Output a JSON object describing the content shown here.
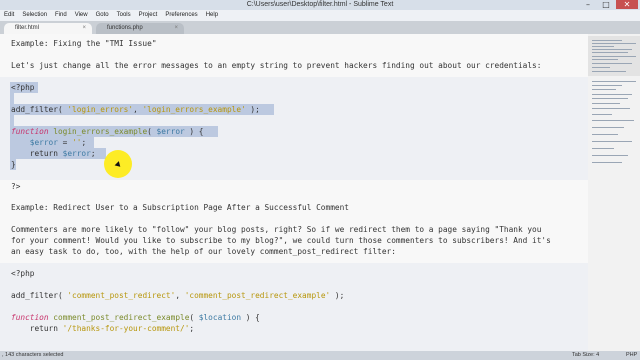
{
  "window": {
    "title": "C:\\Users\\user\\Desktop\\filter.html - Sublime Text"
  },
  "menu": [
    "Edit",
    "Selection",
    "Find",
    "View",
    "Goto",
    "Tools",
    "Project",
    "Preferences",
    "Help"
  ],
  "tabs": [
    {
      "label": "filter.html",
      "active": true
    },
    {
      "label": "functions.php",
      "active": false
    }
  ],
  "editor": {
    "lines": {
      "heading1": "Example: Fixing the \"TMI Issue\"",
      "para1": "Let's just change all the error messages to an empty string to prevent hackers finding out about our credentials:",
      "php_open_1": "<?php",
      "add_filter_1": [
        "add_filter( ",
        "'login_errors'",
        ", ",
        "'login_errors_example'",
        " );"
      ],
      "function_1": [
        "function",
        " ",
        "login_errors_example",
        "( ",
        "$error",
        " ) {"
      ],
      "assign_1": [
        "    ",
        "$error",
        " = ",
        "''",
        ";"
      ],
      "return_1": [
        "    return ",
        "$error",
        ";"
      ],
      "close_brace_1": "}",
      "php_close_1": "?>",
      "heading2": "Example: Redirect User to a Subscription Page After a Successful Comment",
      "para2a": "Commenters are more likely to \"follow\" your blog posts, right? So if we redirect them to a page saying \"Thank you",
      "para2b": "for your comment! Would you like to subscribe to my blog?\", we could turn those commenters to subscribers! And it's",
      "para2c": "an easy task to do, too, with the help of our lovely comment_post_redirect filter:",
      "php_open_2": "<?php",
      "add_filter_2": [
        "add_filter( ",
        "'comment_post_redirect'",
        ", ",
        "'comment_post_redirect_example'",
        " );"
      ],
      "function_2": [
        "function",
        " ",
        "comment_post_redirect_example",
        "( ",
        "$location",
        " ) {"
      ],
      "return_2": [
        "    return ",
        "'/thanks-for-your-comment/'",
        ";"
      ]
    }
  },
  "status": {
    "left": ", 143 characters selected",
    "tab_size": "Tab Size: 4",
    "syntax": "PHP"
  },
  "colors": {
    "keyword": "#c8336b",
    "function_name": "#7a8a2a",
    "string": "#b7960b",
    "variable": "#3d7aa3",
    "selection": "#bcc9e0"
  }
}
